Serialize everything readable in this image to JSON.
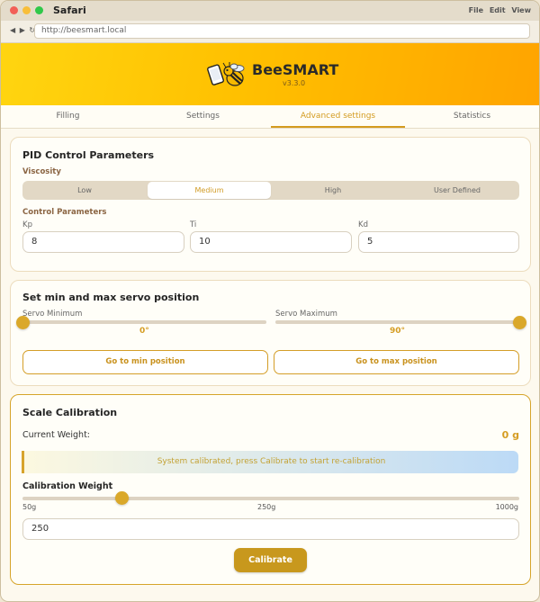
{
  "window": {
    "app_name": "Safari",
    "menu": [
      "File",
      "Edit",
      "View"
    ]
  },
  "browser": {
    "nav_glyphs": [
      "◀",
      "▶",
      "↻"
    ],
    "url": "http://beesmart.local"
  },
  "header": {
    "brand": "BeeSMART",
    "version": "v3.3.0"
  },
  "tabs": [
    {
      "label": "Filling",
      "active": false
    },
    {
      "label": "Settings",
      "active": false
    },
    {
      "label": "Advanced settings",
      "active": true
    },
    {
      "label": "Statistics",
      "active": false
    }
  ],
  "pid": {
    "title": "PID Control Parameters",
    "viscosity_label": "Viscosity",
    "viscosity_options": [
      "Low",
      "Medium",
      "High",
      "User Defined"
    ],
    "viscosity_selected": "Medium",
    "control_label": "Control Parameters",
    "kp": {
      "label": "Kp",
      "value": "8"
    },
    "ti": {
      "label": "Ti",
      "value": "10"
    },
    "kd": {
      "label": "Kd",
      "value": "5"
    }
  },
  "servo": {
    "title": "Set min and max servo position",
    "min_label": "Servo Minimum",
    "min_value": "0°",
    "min_fraction": 0.0,
    "max_label": "Servo Maximum",
    "max_value": "90°",
    "max_fraction": 1.0,
    "go_min": "Go to min position",
    "go_max": "Go to max position"
  },
  "scale": {
    "title": "Scale Calibration",
    "current_label": "Current Weight:",
    "current_value": "0 g",
    "status": "System calibrated, press Calibrate to start re-calibration",
    "weight_label": "Calibration Weight",
    "slider_min": "50g",
    "slider_mid": "250g",
    "slider_max": "1000g",
    "slider_fraction": 0.2,
    "weight_value": "250",
    "calibrate": "Calibrate"
  },
  "colors": {
    "accent": "#d39b1f",
    "hero_start": "#ffd510",
    "hero_end": "#ffa400"
  }
}
